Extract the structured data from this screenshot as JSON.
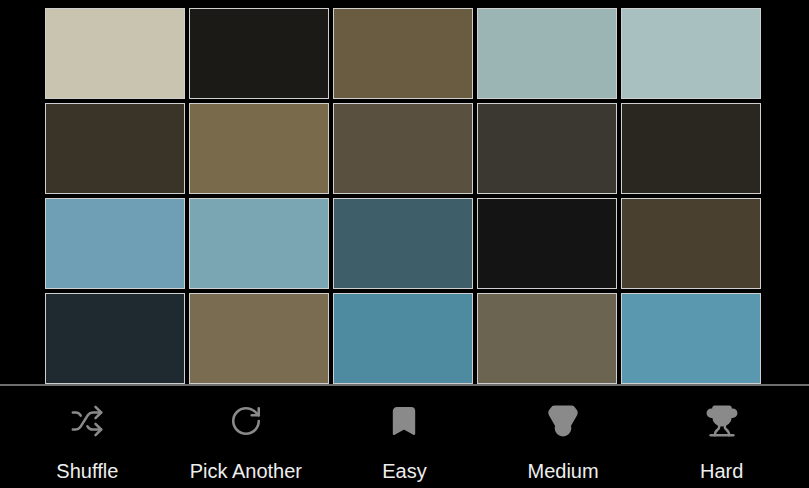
{
  "puzzle": {
    "tiles": [
      {
        "color": "#c8c4b0"
      },
      {
        "color": "#1c1a16"
      },
      {
        "color": "#6a5c40"
      },
      {
        "color": "#9bb5b5"
      },
      {
        "color": "#a8c0c0"
      },
      {
        "color": "#3a3428"
      },
      {
        "color": "#7a6a4c"
      },
      {
        "color": "#5a5040"
      },
      {
        "color": "#3a3830"
      },
      {
        "color": "#2a2720"
      },
      {
        "color": "#6e9fb4"
      },
      {
        "color": "#7aa6b4"
      },
      {
        "color": "#3e5e6a"
      },
      {
        "color": "#141414"
      },
      {
        "color": "#4a4030"
      },
      {
        "color": "#1e2a30"
      },
      {
        "color": "#7a6c50"
      },
      {
        "color": "#4e8aa0"
      },
      {
        "color": "#6a6450"
      },
      {
        "color": "#5a98b0"
      }
    ]
  },
  "action_bar": {
    "items": [
      {
        "label": "Shuffle"
      },
      {
        "label": "Pick Another"
      },
      {
        "label": "Easy"
      },
      {
        "label": "Medium"
      },
      {
        "label": "Hard"
      }
    ]
  }
}
